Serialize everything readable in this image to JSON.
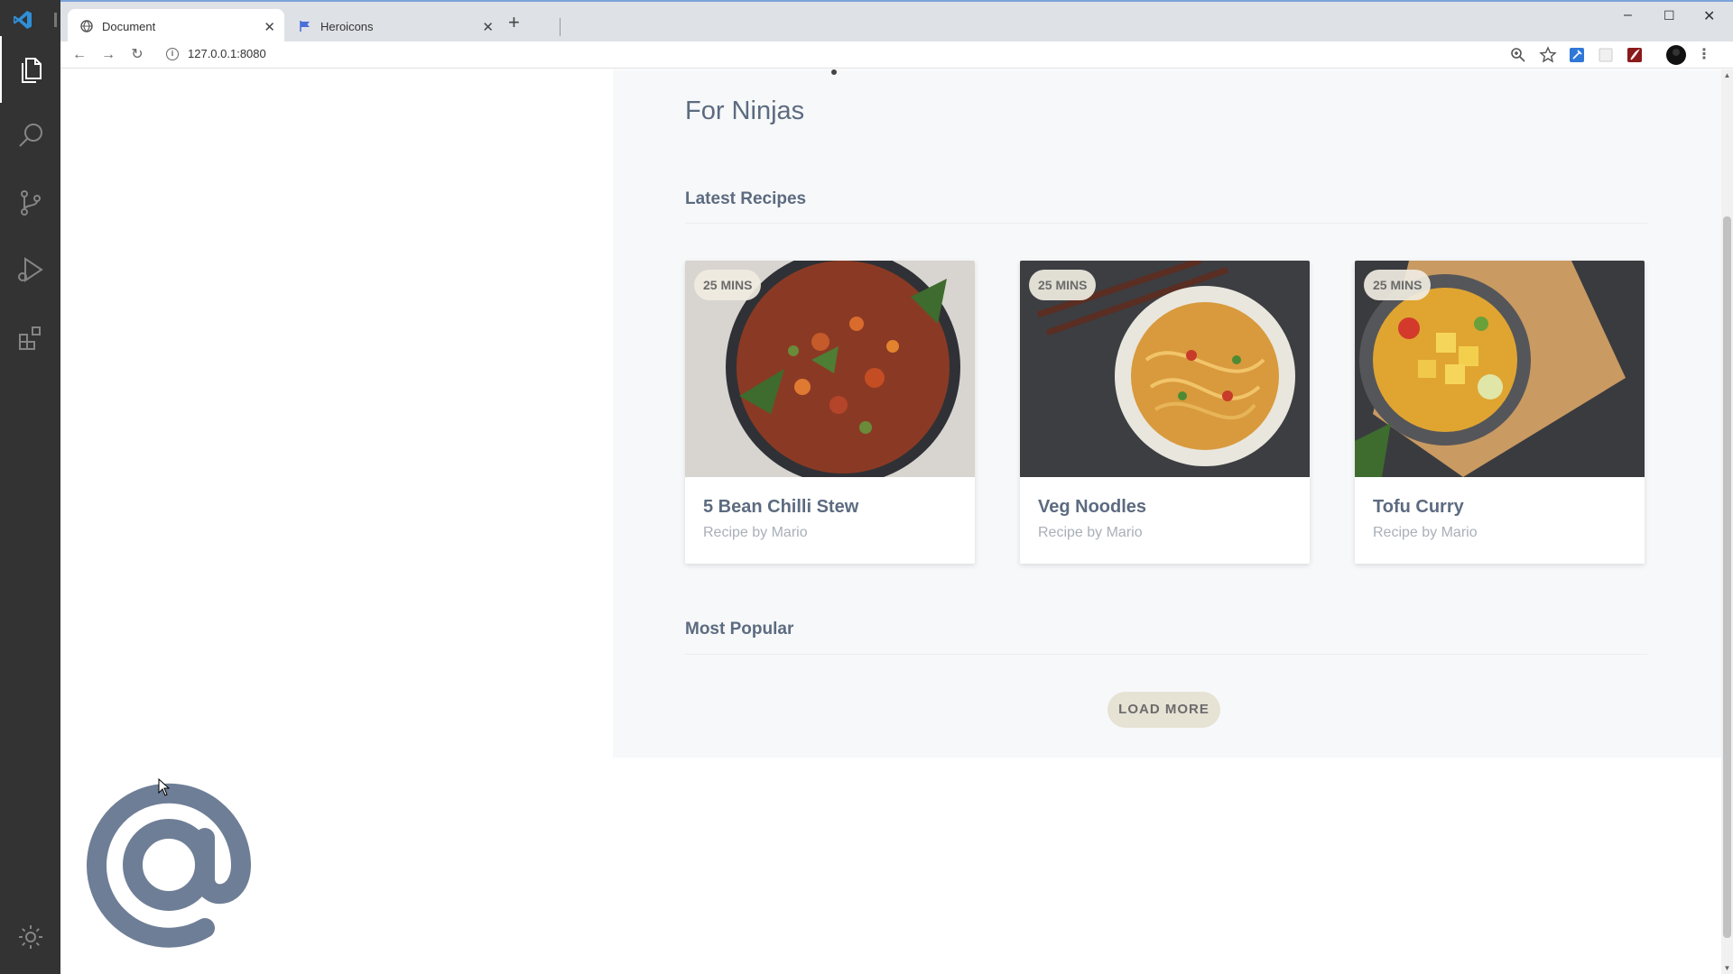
{
  "browser": {
    "tabs": [
      {
        "label": "Document",
        "active": true,
        "icon": "globe-icon"
      },
      {
        "label": "Heroicons",
        "active": false,
        "icon": "flag-icon"
      }
    ],
    "new_tab_label": "+",
    "close_label": "✕",
    "url": "127.0.0.1:8080",
    "window_controls": {
      "minimize": "–",
      "maximize": "☐",
      "close": "✕"
    }
  },
  "page": {
    "subtitle": "For Ninjas",
    "latest_title": "Latest Recipes",
    "popular_title": "Most Popular",
    "load_more": "LOAD MORE",
    "recipes": [
      {
        "title": "5 Bean Chilli Stew",
        "byline": "Recipe by Mario",
        "badge": "25 MINS"
      },
      {
        "title": "Veg Noodles",
        "byline": "Recipe by Mario",
        "badge": "25 MINS"
      },
      {
        "title": "Tofu Curry",
        "byline": "Recipe by Mario",
        "badge": "25 MINS"
      }
    ]
  },
  "colors": {
    "activity_bar": "#333333",
    "heading": "#5c6b80",
    "button_bg": "#e6e2d4",
    "logo": "#6e7e96"
  }
}
